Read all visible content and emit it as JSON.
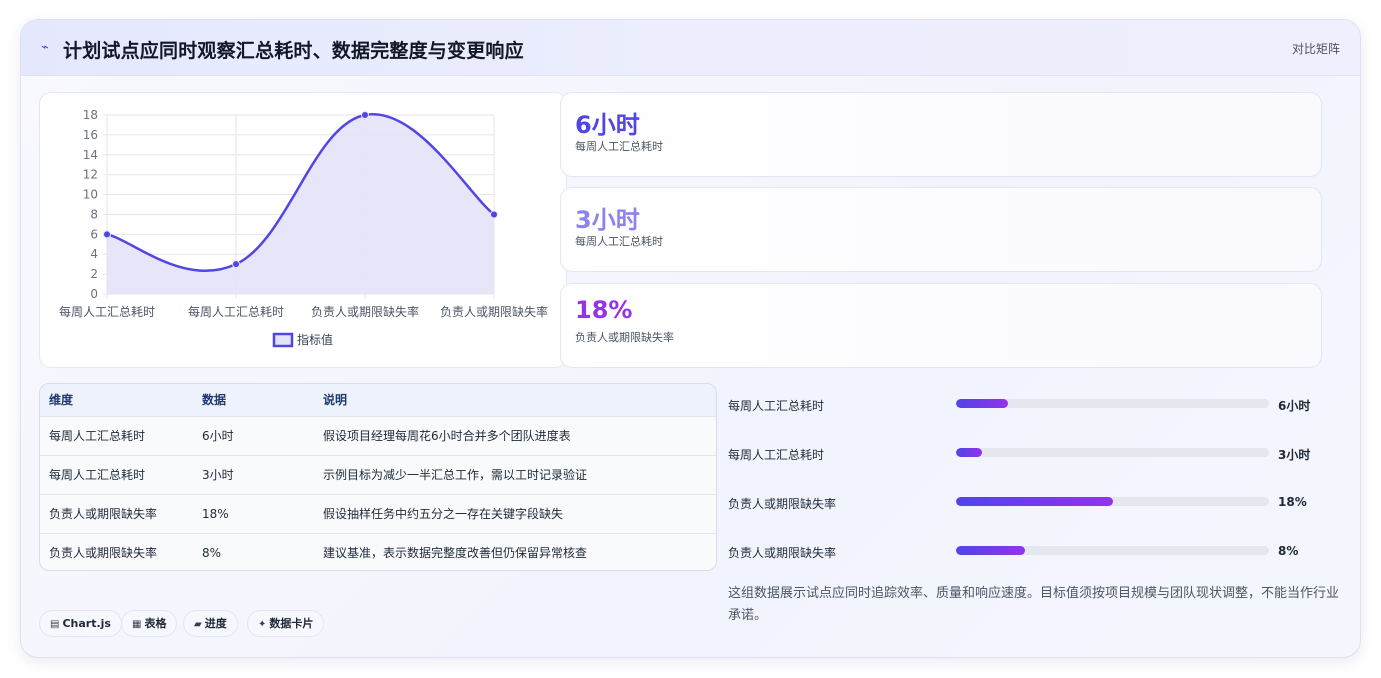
{
  "header": {
    "title": "计划试点应同时观察汇总耗时、数据完整度与变更响应",
    "title_icon": "trend-line-icon",
    "action_label": "对比矩阵"
  },
  "chart_data": {
    "type": "line",
    "categories": [
      "每周人工汇总耗时",
      "每周人工汇总耗时",
      "负责人或期限缺失率",
      "负责人或期限缺失率"
    ],
    "series": [
      {
        "name": "指标值",
        "values": [
          6,
          3,
          18,
          8
        ],
        "color": "#4f46e5",
        "fill": "#e4e3f8"
      }
    ],
    "ylim": [
      0,
      18
    ],
    "yticks": [
      "0",
      "2",
      "4",
      "6",
      "8",
      "10",
      "12",
      "14",
      "16",
      "18"
    ],
    "grid": true,
    "legend": "bottom",
    "xlabel": "",
    "ylabel": ""
  },
  "stats": [
    {
      "value": "6小时",
      "label": "每周人工汇总耗时",
      "color": "#4f46e5"
    },
    {
      "value": "3小时",
      "label": "每周人工汇总耗时",
      "color": "#8b83ef"
    },
    {
      "value": "18%",
      "label": "负责人或期限缺失率",
      "color": "#9333ea"
    }
  ],
  "table": {
    "headers": [
      "维度",
      "数据",
      "说明"
    ],
    "rows": [
      [
        "每周人工汇总耗时",
        "6小时",
        "假设项目经理每周花6小时合并多个团队进度表"
      ],
      [
        "每周人工汇总耗时",
        "3小时",
        "示例目标为减少一半汇总工作，需以工时记录验证"
      ],
      [
        "负责人或期限缺失率",
        "18%",
        "假设抽样任务中约五分之一存在关键字段缺失"
      ],
      [
        "负责人或期限缺失率",
        "8%",
        "建议基准，表示数据完整度改善但仍保留异常核查"
      ]
    ]
  },
  "progress": [
    {
      "label": "每周人工汇总耗时",
      "value": "6小时",
      "fraction": 0.167
    },
    {
      "label": "每周人工汇总耗时",
      "value": "3小时",
      "fraction": 0.083
    },
    {
      "label": "负责人或期限缺失率",
      "value": "18%",
      "fraction": 0.5
    },
    {
      "label": "负责人或期限缺失率",
      "value": "8%",
      "fraction": 0.222
    }
  ],
  "note": "这组数据展示试点应同时追踪效率、质量和响应速度。目标值须按项目规模与团队现状调整，不能当作行业承诺。",
  "tags": [
    {
      "icon": "chart-icon",
      "label": "Chart.js"
    },
    {
      "icon": "table-icon",
      "label": "表格"
    },
    {
      "icon": "progress-icon",
      "label": "进度"
    },
    {
      "icon": "sparkle-icon",
      "label": "数据卡片"
    }
  ]
}
